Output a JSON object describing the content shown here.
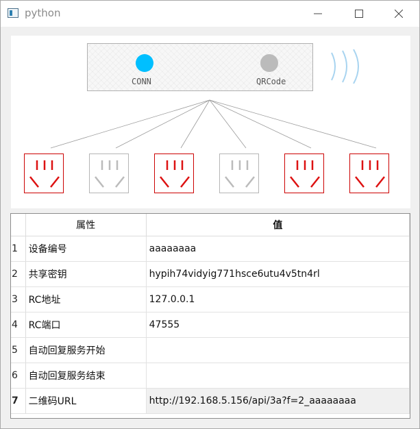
{
  "window": {
    "title": "python"
  },
  "device": {
    "conn_label": "CONN",
    "qrcode_label": "QRCode",
    "conn_color": "#00bfff",
    "qrcode_color": "#bbbbbb"
  },
  "sockets": [
    {
      "active": true
    },
    {
      "active": false
    },
    {
      "active": true
    },
    {
      "active": false
    },
    {
      "active": true
    },
    {
      "active": true
    }
  ],
  "table": {
    "headers": {
      "property": "属性",
      "value": "值"
    },
    "rows": [
      {
        "index": "1",
        "property": "设备编号",
        "value": "aaaaaaaa"
      },
      {
        "index": "2",
        "property": "共享密钥",
        "value": "hypih74vidyig771hsce6utu4v5tn4rl"
      },
      {
        "index": "3",
        "property": "RC地址",
        "value": "127.0.0.1"
      },
      {
        "index": "4",
        "property": "RC端口",
        "value": "47555"
      },
      {
        "index": "5",
        "property": "自动回复服务开始",
        "value": ""
      },
      {
        "index": "6",
        "property": "自动回复服务结束",
        "value": ""
      },
      {
        "index": "7",
        "property": "二维码URL",
        "value": "http://192.168.5.156/api/3a?f=2_aaaaaaaa"
      }
    ]
  },
  "colors": {
    "active": "#dd1111",
    "inactive": "#bbbbbb",
    "wave": "#a8d4f0"
  }
}
